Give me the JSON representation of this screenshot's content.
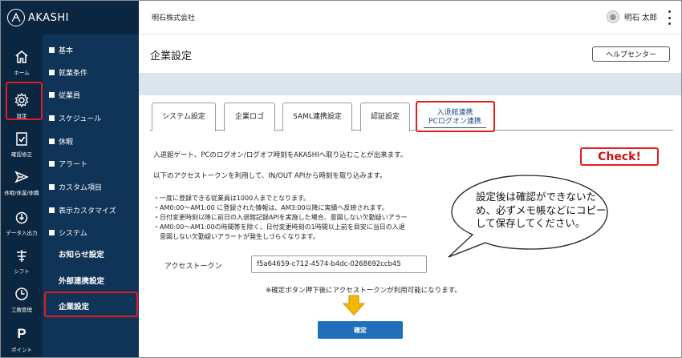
{
  "app": {
    "logo_text": "AKASHI"
  },
  "rail": [
    {
      "label": "ホーム",
      "icon": "home-icon"
    },
    {
      "label": "設定",
      "icon": "gear-icon"
    },
    {
      "label": "確認修正",
      "icon": "clipboard-check-icon"
    },
    {
      "label": "休暇/休業/休職",
      "icon": "paper-plane-icon"
    },
    {
      "label": "データ入出力",
      "icon": "power-icon"
    },
    {
      "label": "シフト",
      "icon": "shift-icon"
    },
    {
      "label": "工数管理",
      "icon": "clock-icon"
    },
    {
      "label": "ポイント",
      "icon": "p-icon"
    }
  ],
  "nav": {
    "items": [
      "基本",
      "就業条件",
      "従業員",
      "スケジュール",
      "休暇",
      "アラート",
      "カスタム項目",
      "表示カスタマイズ",
      "システム"
    ],
    "subitems": [
      "お知らせ設定",
      "外部連携設定",
      "企業設定"
    ]
  },
  "topbar": {
    "company": "明石株式会社",
    "user": "明石 太郎"
  },
  "page": {
    "title": "企業設定",
    "help_label": "ヘルプセンター"
  },
  "tabs": [
    "システム設定",
    "企業ロゴ",
    "SAML連携設定",
    "認証設定"
  ],
  "active_tab": {
    "line1": "入退館連携",
    "line2": "PCログオン連携"
  },
  "content": {
    "intro1": "入退館ゲート、PCのログオン/ログオフ時刻をAKASHIへ取り込むことが出来ます。",
    "intro2": "以下のアクセストークンを利用して、IN/OUT APIから時刻を取り込みます。",
    "bullets": [
      "・一度に登録できる従業員は1000人までとなります。",
      "・AM0:00～AM1:00 に登録された情報は、AM3:00以降に実績へ反映されます。",
      "・日付変更時刻以降に前日の入退館記録APIを実施した場合、意図しない欠勤疑いアラー",
      "・AM0:00～AM1:00の時間帯を除く、日付変更時刻の1時間以上前を目安に当日の入退",
      "　意図しない欠勤疑いアラートが発生しづらくなります。"
    ],
    "token_label": "アクセストークン",
    "token_value": "f5a64659-c712-4574-b4dc-0268692ccb45",
    "note": "※確定ボタン押下後にアクセストークンが利用可能になります。",
    "confirm_label": "確定"
  },
  "annotation": {
    "check_label": "Check!",
    "bubble_text": "設定後は確認ができないため、必ずメモ帳などにコピーして保存してください。"
  },
  "colors": {
    "sidebar": "#0f3457",
    "rail": "#0b2640",
    "highlight": "#e31d1d",
    "accent": "#1f6fba",
    "arrow": "#f5b800"
  }
}
